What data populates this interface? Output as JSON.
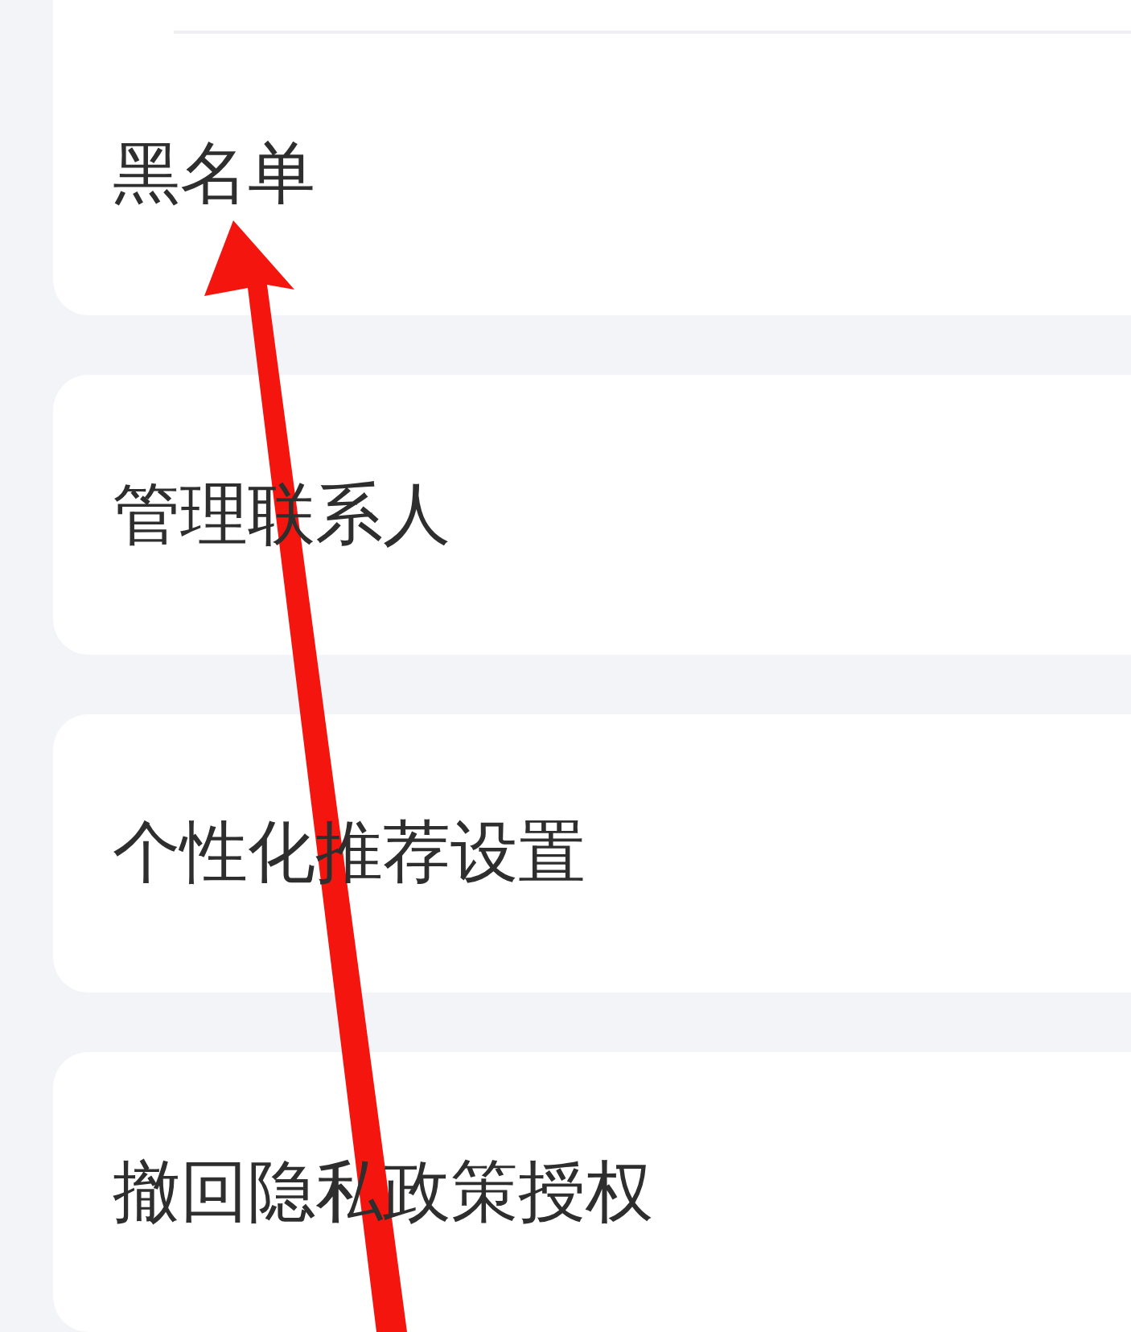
{
  "settings_items": [
    {
      "label": "黑名单"
    },
    {
      "label": "管理联系人"
    },
    {
      "label": "个性化推荐设置"
    },
    {
      "label": "撤回隐私政策授权"
    }
  ]
}
